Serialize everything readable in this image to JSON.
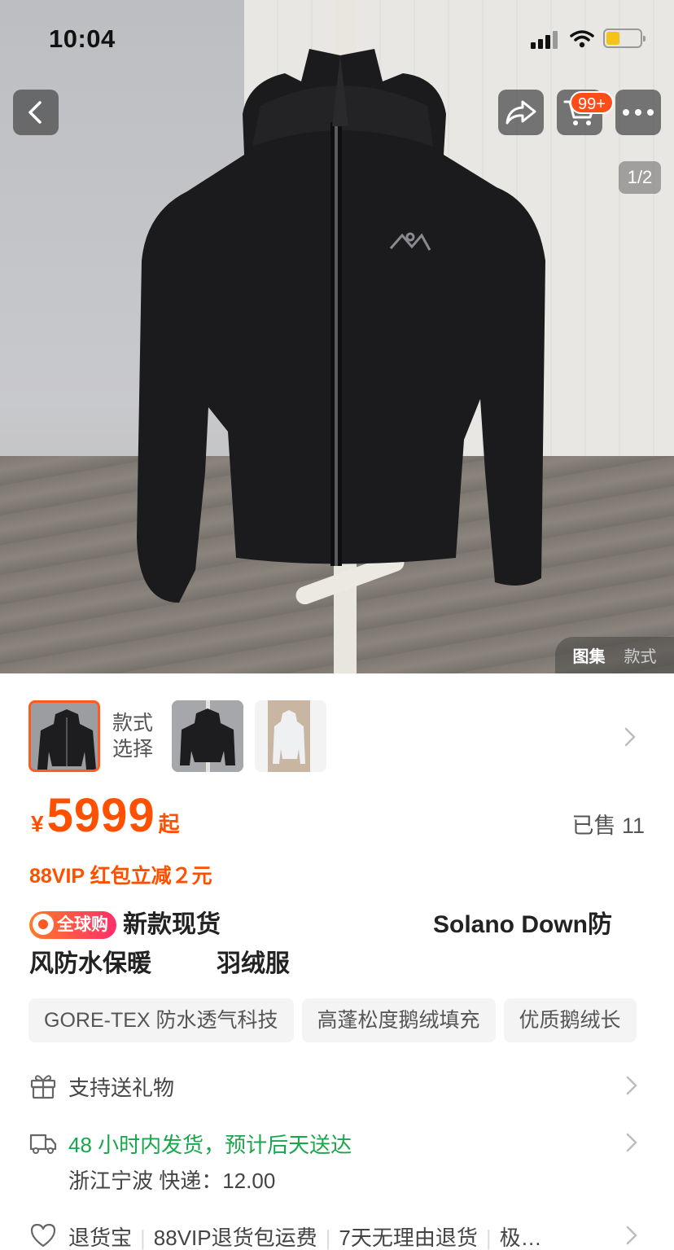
{
  "status_bar": {
    "time": "10:04"
  },
  "header": {
    "cart_badge": "99+",
    "page_indicator": "1/2"
  },
  "gallery_switch": {
    "active": "图集",
    "inactive": "款式"
  },
  "styles": {
    "label_line1": "款式",
    "label_line2": "选择"
  },
  "price": {
    "currency": "¥",
    "amount": "5999",
    "suffix": "起",
    "sold": "已售 11"
  },
  "promo": {
    "vip": "88VIP 红包立减２元"
  },
  "title": {
    "badge": "全球购",
    "line1a": "新款现货",
    "line1b": "Solano Down防",
    "line2a": "风防水保暖",
    "line2b": "羽绒服"
  },
  "tags": [
    "GORE-TEX 防水透气科技",
    "高蓬松度鹅绒填充",
    "优质鹅绒长"
  ],
  "gift": {
    "label": "支持送礼物"
  },
  "delivery": {
    "line1": "48 小时内发货，预计后天送达",
    "line2": "浙江宁波  快递：12.00"
  },
  "returns": {
    "items": [
      "退货宝",
      "88VIP退货包运费",
      "7天无理由退货",
      "极…"
    ]
  },
  "colors": {
    "accent": "#ff5000",
    "green": "#19a74b"
  }
}
